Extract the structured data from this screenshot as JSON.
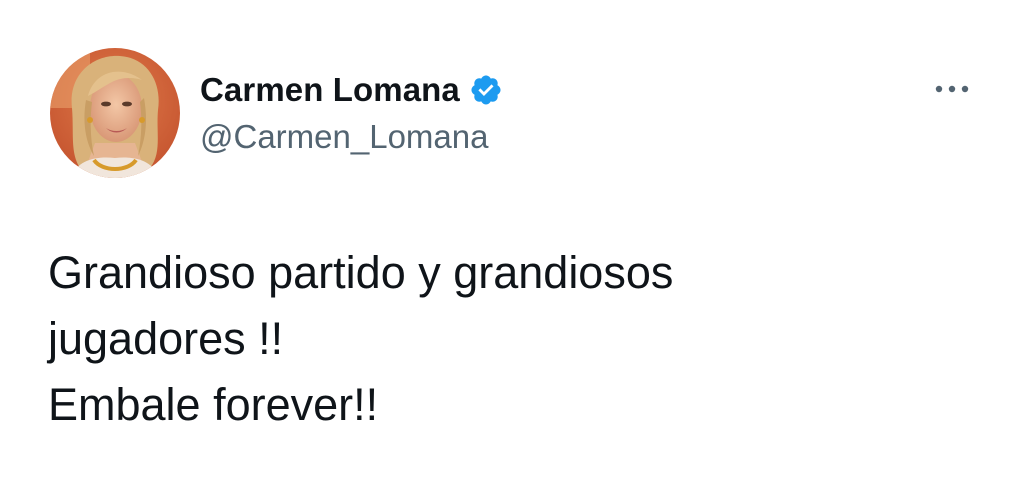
{
  "author": {
    "display_name": "Carmen Lomana",
    "handle": "@Carmen_Lomana",
    "verified": true,
    "avatar_icon": "profile-photo",
    "verified_icon": "verified-badge-icon"
  },
  "menu": {
    "icon": "more-options-icon"
  },
  "tweet": {
    "lines": [
      "Grandioso partido y grandiosos",
      "jugadores !!",
      "Embale forever!!"
    ]
  },
  "colors": {
    "text_primary": "#0f1419",
    "text_secondary": "#536471",
    "verified_blue": "#1d9bf0",
    "background": "#ffffff"
  }
}
